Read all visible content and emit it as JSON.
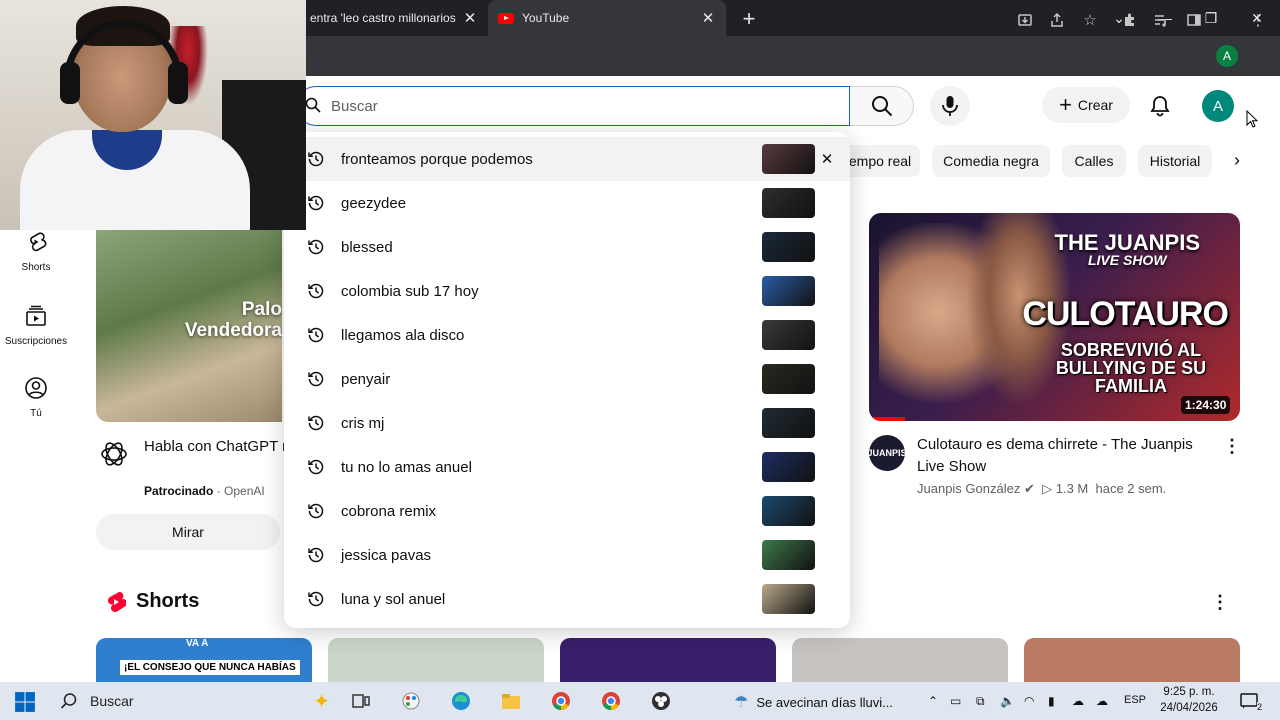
{
  "browser": {
    "tabs": [
      {
        "title": "entra 'leo castro millonarios",
        "active": false
      },
      {
        "title": "YouTube",
        "active": true
      }
    ],
    "new_tab": "+",
    "profile_initial": "A"
  },
  "youtube": {
    "search": {
      "placeholder": "Buscar",
      "value": ""
    },
    "create_label": "Crear",
    "avatar_initial": "A",
    "chips": [
      "empo real",
      "Comedia negra",
      "Calles",
      "Historial"
    ],
    "sidebar": [
      {
        "label": "Shorts",
        "icon": "shorts-icon"
      },
      {
        "label": "Suscripciones",
        "icon": "subscriptions-icon"
      },
      {
        "label": "Tú",
        "icon": "user-icon"
      }
    ],
    "ad": {
      "overlay_line1": "Palo",
      "overlay_line2": "Vendedora",
      "title": "Habla con ChatGPT mediante voz con v",
      "sponsored": "Patrocinado",
      "advertiser": "OpenAI",
      "button": "Mirar"
    },
    "video": {
      "thumb_brand": "THE JUANPIS",
      "thumb_brand_sub": "LIVE SHOW",
      "thumb_big": "CULOTAURO",
      "thumb_sub": "SOBREVIVIÓ AL BULLYING DE SU FAMILIA",
      "duration": "1:24:30",
      "channel_avatar": "JUANPIS",
      "title": "Culotauro es dema chirrete - The Juanpis Live Show",
      "channel": "Juanpis González",
      "views": "1.3 M",
      "age": "hace 2 sem."
    },
    "shorts_title": "Shorts",
    "shorts": [
      {
        "overlay_top": "VA A",
        "overlay": "¡EL CONSEJO QUE NUNCA HABÍAS",
        "color": "#2f7fcf"
      },
      {
        "color": "#c9d6c9"
      },
      {
        "color": "#3a1f6b"
      },
      {
        "color": "#c7c3c0"
      },
      {
        "color": "#b87a62"
      }
    ],
    "suggestions": [
      {
        "text": "fronteamos porque podemos",
        "thumb": "#5a3a3f"
      },
      {
        "text": "geezydee",
        "thumb": "#2e2e2e"
      },
      {
        "text": "blessed",
        "thumb": "#1b2a3a"
      },
      {
        "text": "colombia sub 17 hoy",
        "thumb": "#2b5da8"
      },
      {
        "text": "llegamos ala disco",
        "thumb": "#3a3a3a"
      },
      {
        "text": "penyair",
        "thumb": "#2a2a22"
      },
      {
        "text": "cris mj",
        "thumb": "#1f2b33"
      },
      {
        "text": "tu no lo amas anuel",
        "thumb": "#1c2e63"
      },
      {
        "text": "cobrona remix",
        "thumb": "#1b4a6e"
      },
      {
        "text": "jessica pavas",
        "thumb": "#3e7a4a"
      },
      {
        "text": "luna y sol anuel",
        "thumb": "#b9a98a"
      }
    ]
  },
  "taskbar": {
    "search": "Buscar",
    "weather": "Se avecinan días lluvi...",
    "lang": "ESP",
    "time": "9:25 p. m.",
    "date": "24/04/2026",
    "notifications": "2"
  }
}
